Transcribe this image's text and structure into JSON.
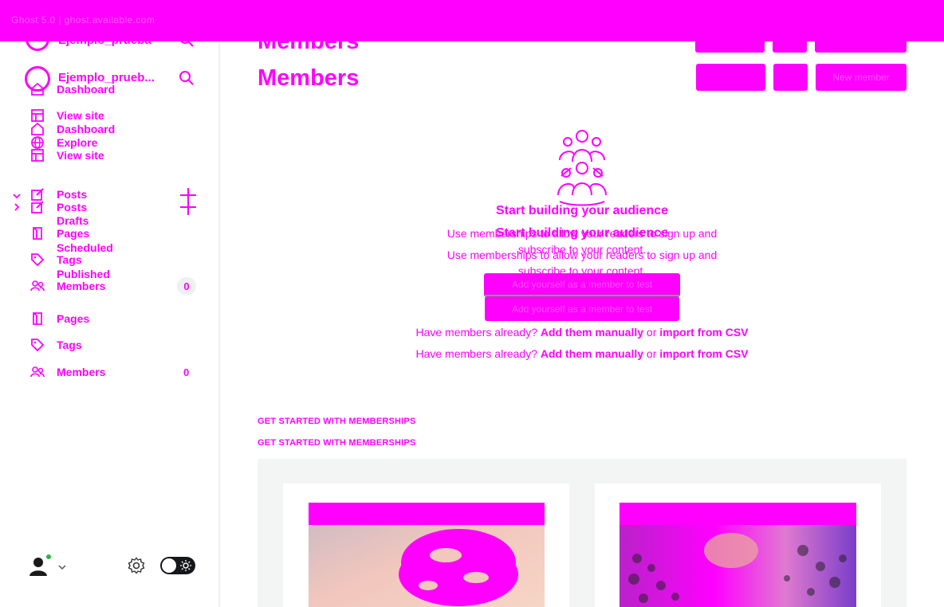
{
  "window": {
    "title": "Ghost 5.0 | ghost.available.com"
  },
  "sidebar": {
    "site_name": "Ejemplo_prueb...",
    "site_name_ghost": "Ejemplo_prueba",
    "primary": [
      {
        "label": "Dashboard",
        "icon": "home-icon"
      },
      {
        "label": "View site",
        "icon": "layout-icon"
      },
      {
        "label": "Dashboard",
        "icon": "home-icon"
      },
      {
        "label": "Explore",
        "icon": "globe-icon"
      },
      {
        "label": "View site",
        "icon": "layout-icon"
      }
    ],
    "posts_label": "Posts",
    "posts_ghost": "Posts",
    "sub": [
      "Drafts",
      "Scheduled",
      "Published"
    ],
    "pages_ghost": "Pages",
    "tags_ghost": "Tags",
    "members_ghost": "Members",
    "members_count_ghost": "0",
    "pages_label": "Pages",
    "tags_label": "Tags",
    "members_label": "Members",
    "members_count": "0"
  },
  "header": {
    "title_ghost": "Members",
    "title": "Members",
    "new_member_label": "New member"
  },
  "empty_state": {
    "title": "Start building your audience",
    "title_ghost": "Start building your audience",
    "description": "Use memberships to allow your readers to sign up and subscribe to your content.",
    "description_ghost": "Use memberships to allow your readers to sign up and subscribe to your content.",
    "cta_label": "Add yourself as a member to test",
    "cta_ghost": "Add yourself as a member to test",
    "have_members_prefix": "Have members already?",
    "add_manually": "Add them manually",
    "or": "or",
    "import_csv": "import from CSV"
  },
  "get_started": {
    "heading": "GET STARTED WITH MEMBERSHIPS",
    "heading_ghost": "GET STARTED WITH MEMBERSHIPS"
  },
  "footer": {
    "avatar_icon": "user-avatar-icon",
    "settings_icon": "gear-icon",
    "theme_toggle_icon": "sun-icon",
    "status_color": "#2fb344"
  },
  "colors": {
    "accent": "#ff00ff",
    "card_bg": "#f3f4f4",
    "cta_underline": "#30cf43"
  }
}
